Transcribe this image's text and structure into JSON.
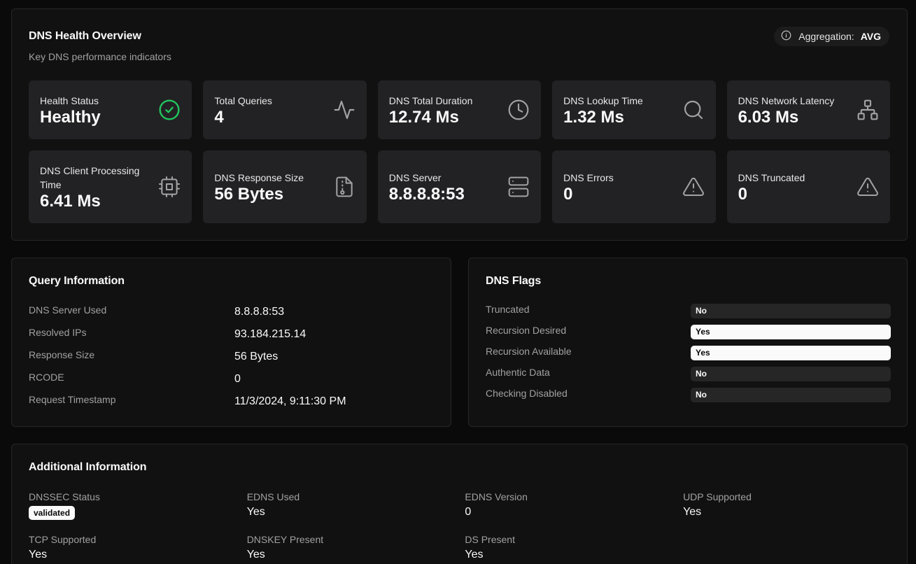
{
  "overview": {
    "title": "DNS Health Overview",
    "subtitle": "Key DNS performance indicators",
    "aggregation_label": "Aggregation:",
    "aggregation_value": "AVG",
    "metrics": [
      {
        "label": "Health Status",
        "value": "Healthy",
        "icon": "check-circle-icon"
      },
      {
        "label": "Total Queries",
        "value": "4",
        "icon": "activity-icon"
      },
      {
        "label": "DNS Total Duration",
        "value": "12.74 Ms",
        "icon": "clock-icon"
      },
      {
        "label": "DNS Lookup Time",
        "value": "1.32 Ms",
        "icon": "search-icon"
      },
      {
        "label": "DNS Network Latency",
        "value": "6.03 Ms",
        "icon": "network-icon"
      },
      {
        "label": "DNS Client Processing Time",
        "value": "6.41 Ms",
        "icon": "cpu-icon"
      },
      {
        "label": "DNS Response Size",
        "value": "56 Bytes",
        "icon": "file-archive-icon"
      },
      {
        "label": "DNS Server",
        "value": "8.8.8.8:53",
        "icon": "server-icon"
      },
      {
        "label": "DNS Errors",
        "value": "0",
        "icon": "warning-icon"
      },
      {
        "label": "DNS Truncated",
        "value": "0",
        "icon": "warning-icon"
      }
    ]
  },
  "query": {
    "title": "Query Information",
    "rows": [
      {
        "label": "DNS Server Used",
        "value": "8.8.8.8:53"
      },
      {
        "label": "Resolved IPs",
        "value": "93.184.215.14"
      },
      {
        "label": "Response Size",
        "value": "56 Bytes"
      },
      {
        "label": "RCODE",
        "value": "0"
      },
      {
        "label": "Request Timestamp",
        "value": "11/3/2024, 9:11:30 PM"
      }
    ]
  },
  "flags": {
    "title": "DNS Flags",
    "rows": [
      {
        "label": "Truncated",
        "value": "No"
      },
      {
        "label": "Recursion Desired",
        "value": "Yes"
      },
      {
        "label": "Recursion Available",
        "value": "Yes"
      },
      {
        "label": "Authentic Data",
        "value": "No"
      },
      {
        "label": "Checking Disabled",
        "value": "No"
      }
    ]
  },
  "additional": {
    "title": "Additional Information",
    "items": [
      {
        "label": "DNSSEC Status",
        "value": "validated"
      },
      {
        "label": "EDNS Used",
        "value": "Yes"
      },
      {
        "label": "EDNS Version",
        "value": "0"
      },
      {
        "label": "UDP Supported",
        "value": "Yes"
      },
      {
        "label": "TCP Supported",
        "value": "Yes"
      },
      {
        "label": "DNSKEY Present",
        "value": "Yes"
      },
      {
        "label": "DS Present",
        "value": "Yes"
      }
    ]
  },
  "colors": {
    "background": "#0a0a0a",
    "card": "#111111",
    "tile": "#222224",
    "healthy_accent": "#22c55e"
  }
}
